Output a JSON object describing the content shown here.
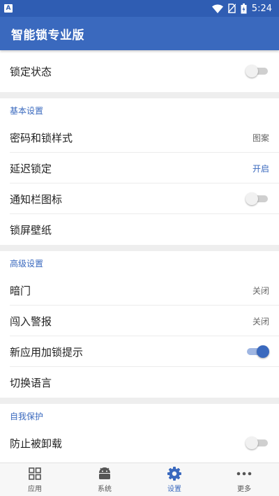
{
  "status_bar": {
    "app_icon_letter": "A",
    "time": "5:24"
  },
  "app_bar": {
    "title": "智能锁专业版"
  },
  "lock_status": {
    "label": "锁定状态",
    "toggle_on": false
  },
  "basic_settings": {
    "header": "基本设置",
    "items": [
      {
        "label": "密码和锁样式",
        "value": "图案"
      },
      {
        "label": "延迟锁定",
        "value": "开启"
      },
      {
        "label": "通知栏图标",
        "toggle_on": false
      },
      {
        "label": "锁屏壁纸"
      }
    ]
  },
  "advanced_settings": {
    "header": "高级设置",
    "items": [
      {
        "label": "暗门",
        "value": "关闭"
      },
      {
        "label": "闯入警报",
        "value": "关闭"
      },
      {
        "label": "新应用加锁提示",
        "toggle_on": true
      },
      {
        "label": "切换语言"
      }
    ]
  },
  "self_protection": {
    "header": "自我保护",
    "items": [
      {
        "label": "防止被卸载",
        "toggle_on": false
      }
    ]
  },
  "bottom_nav": {
    "items": [
      {
        "label": "应用",
        "icon": "grid-icon",
        "active": false
      },
      {
        "label": "系统",
        "icon": "android-icon",
        "active": false
      },
      {
        "label": "设置",
        "icon": "gear-icon",
        "active": true
      },
      {
        "label": "更多",
        "icon": "more-dots-icon",
        "active": false
      }
    ]
  },
  "colors": {
    "primary": "#3a69be",
    "status_bar": "#2f5db3",
    "section_gap": "#eeeeee"
  }
}
